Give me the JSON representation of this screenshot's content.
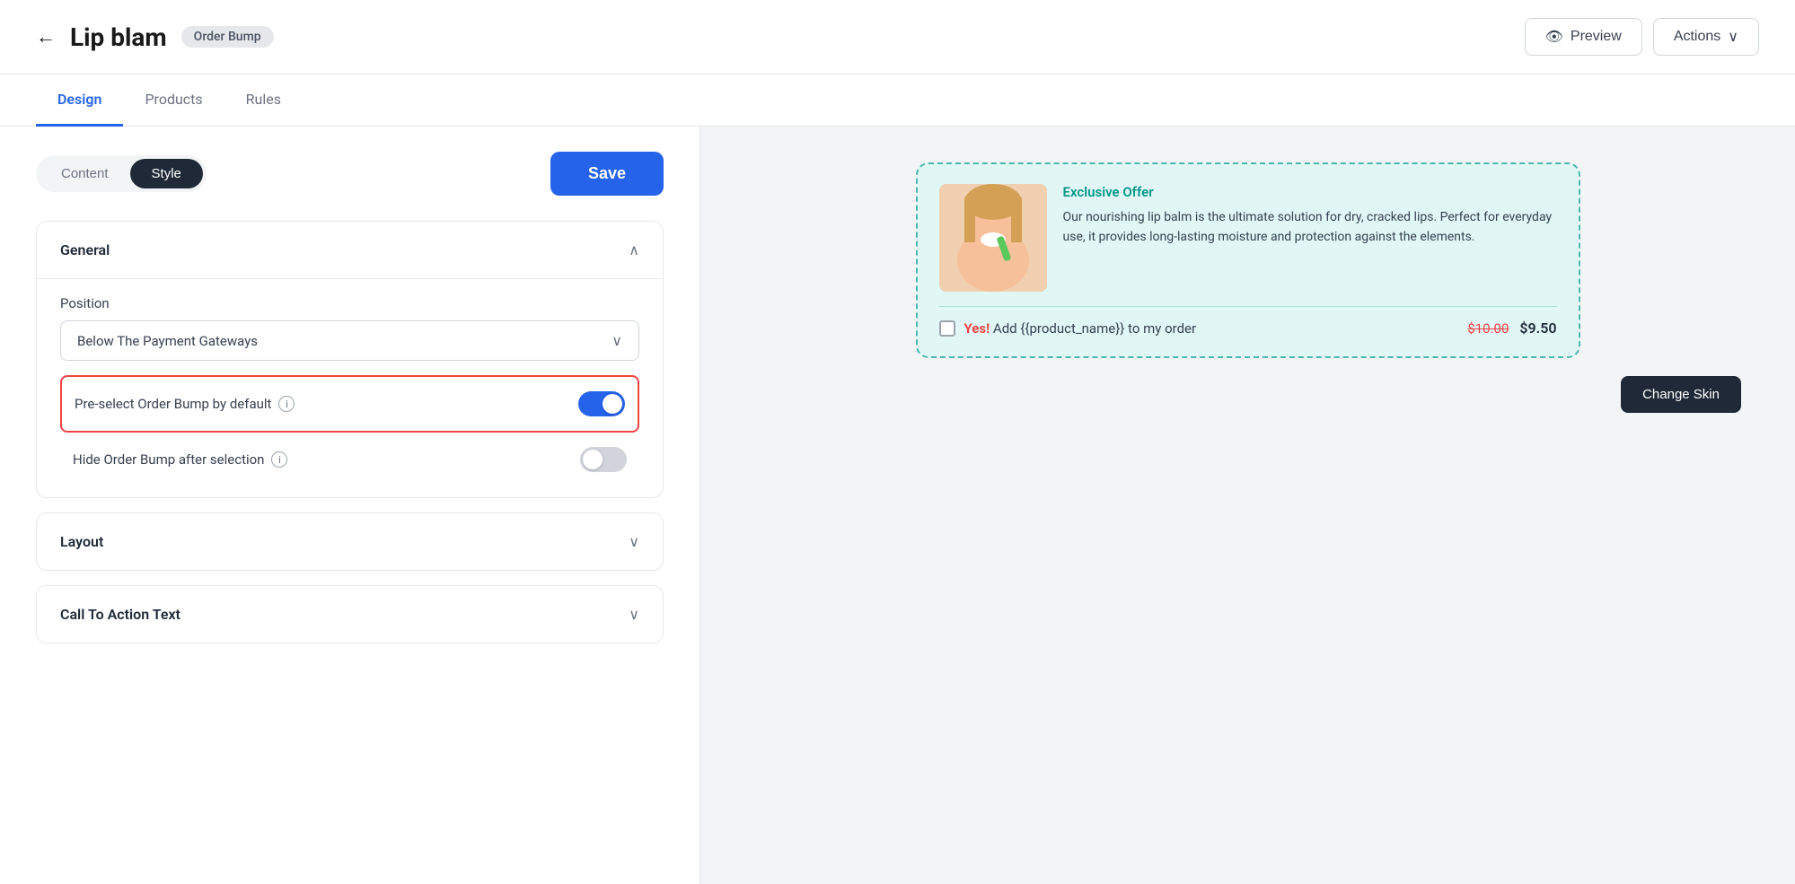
{
  "header": {
    "back_label": "←",
    "title": "Lip blam",
    "badge": "Order Bump",
    "preview_label": "Preview",
    "actions_label": "Actions",
    "actions_chevron": "∨"
  },
  "tabs": [
    {
      "id": "design",
      "label": "Design",
      "active": true
    },
    {
      "id": "products",
      "label": "Products",
      "active": false
    },
    {
      "id": "rules",
      "label": "Rules",
      "active": false
    }
  ],
  "content_style_toggle": {
    "content_label": "Content",
    "style_label": "Style",
    "active": "style"
  },
  "save_label": "Save",
  "general_section": {
    "title": "General",
    "position_label": "Position",
    "position_value": "Below The Payment Gateways",
    "preselect_label": "Pre-select Order Bump by default",
    "preselect_enabled": true,
    "hide_label": "Hide Order Bump after selection",
    "hide_enabled": false
  },
  "layout_section": {
    "title": "Layout"
  },
  "cta_section": {
    "title": "Call To Action Text"
  },
  "preview": {
    "exclusive_label": "Exclusive Offer",
    "description": "Our nourishing lip balm is the ultimate solution for dry, cracked lips. Perfect for everyday use, it provides long-lasting moisture and protection against the elements.",
    "cta_yes": "Yes!",
    "cta_text": " Add {{product_name}} to my order",
    "price_original": "$10.00",
    "price_new": "$9.50",
    "change_skin_label": "Change Skin"
  }
}
